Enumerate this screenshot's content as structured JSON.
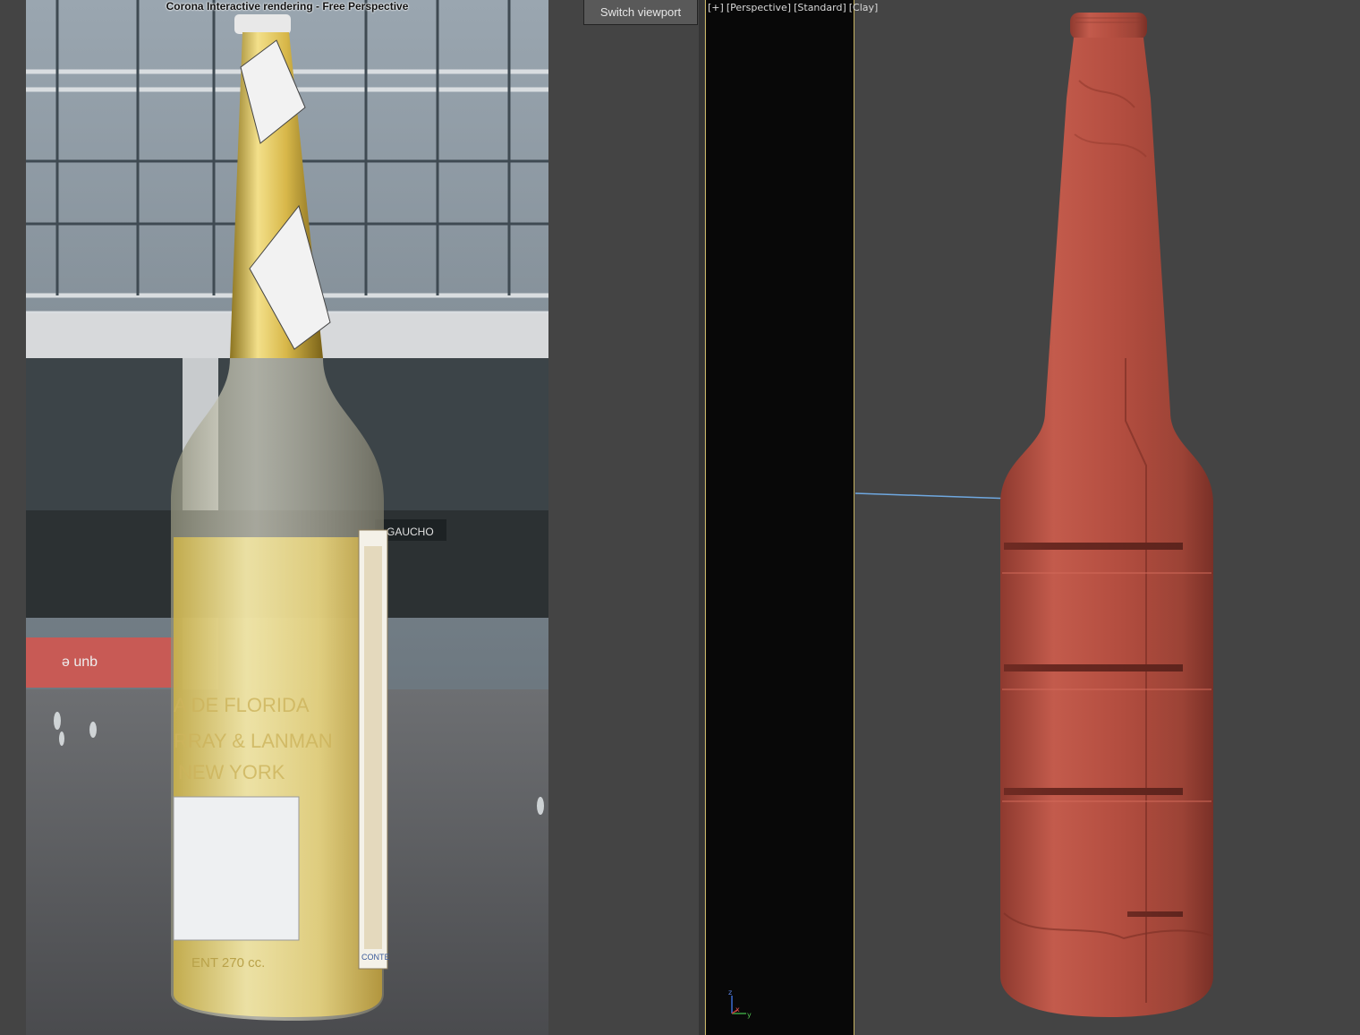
{
  "render_window": {
    "title": "Corona Interactive rendering - Free Perspective",
    "scene": {
      "neck_text": "",
      "bottle_text_line1": "A DE FLORIDA",
      "bottle_text_line2": "RRAY & LANMAN",
      "bottle_text_line3": "NEW YORK",
      "bottle_volume_text": "ENT 270 cc.",
      "sign_text": "GAUCHO",
      "banner_text": "ǝ unb",
      "side_label_text": "CONTE"
    }
  },
  "toolbar": {
    "switch_viewport_label": "Switch viewport"
  },
  "viewport": {
    "label_plus": "[+]",
    "label_view": "[Perspective]",
    "label_shading": "[Standard]",
    "label_style": "[Clay]",
    "gizmo_axes": [
      "z",
      "x",
      "y"
    ],
    "clay_color": "#b04a3c",
    "background_color": "#444444"
  }
}
